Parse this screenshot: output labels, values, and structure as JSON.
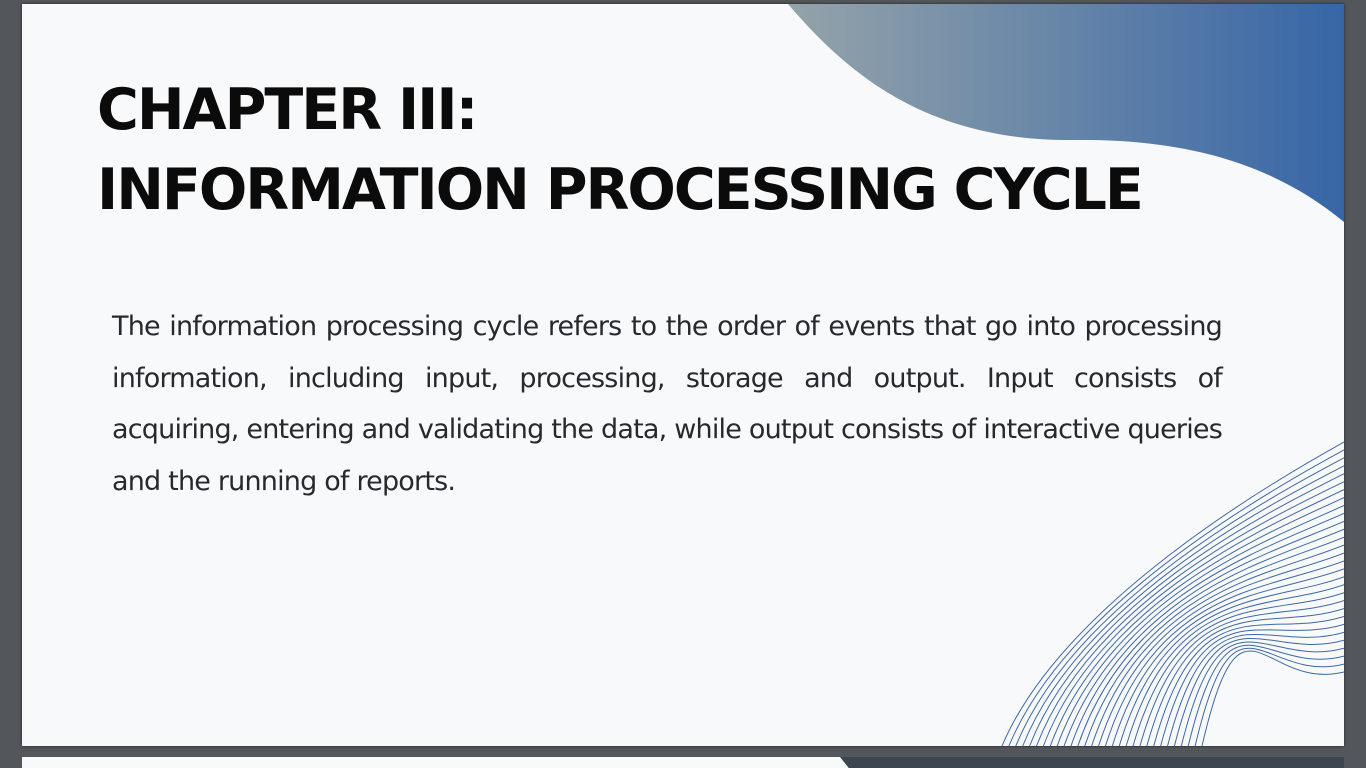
{
  "slide": {
    "title_line1": "CHAPTER III:",
    "title_line2": "INFORMATION PROCESSING CYCLE",
    "body": "The information processing cycle refers to the order of events that go into processing information, including input, processing, storage and output. Input consists of acquiring, entering and validating the data, while output consists of interactive queries and the running of reports."
  },
  "colors": {
    "viewer_background": "#53575b",
    "slide_background": "#f8f9fa",
    "title": "#0b0b0b",
    "body": "#262a2e",
    "gradient_start": "#94a3a9",
    "gradient_end": "#3766a7",
    "wave_lines": "#3f68a3"
  }
}
